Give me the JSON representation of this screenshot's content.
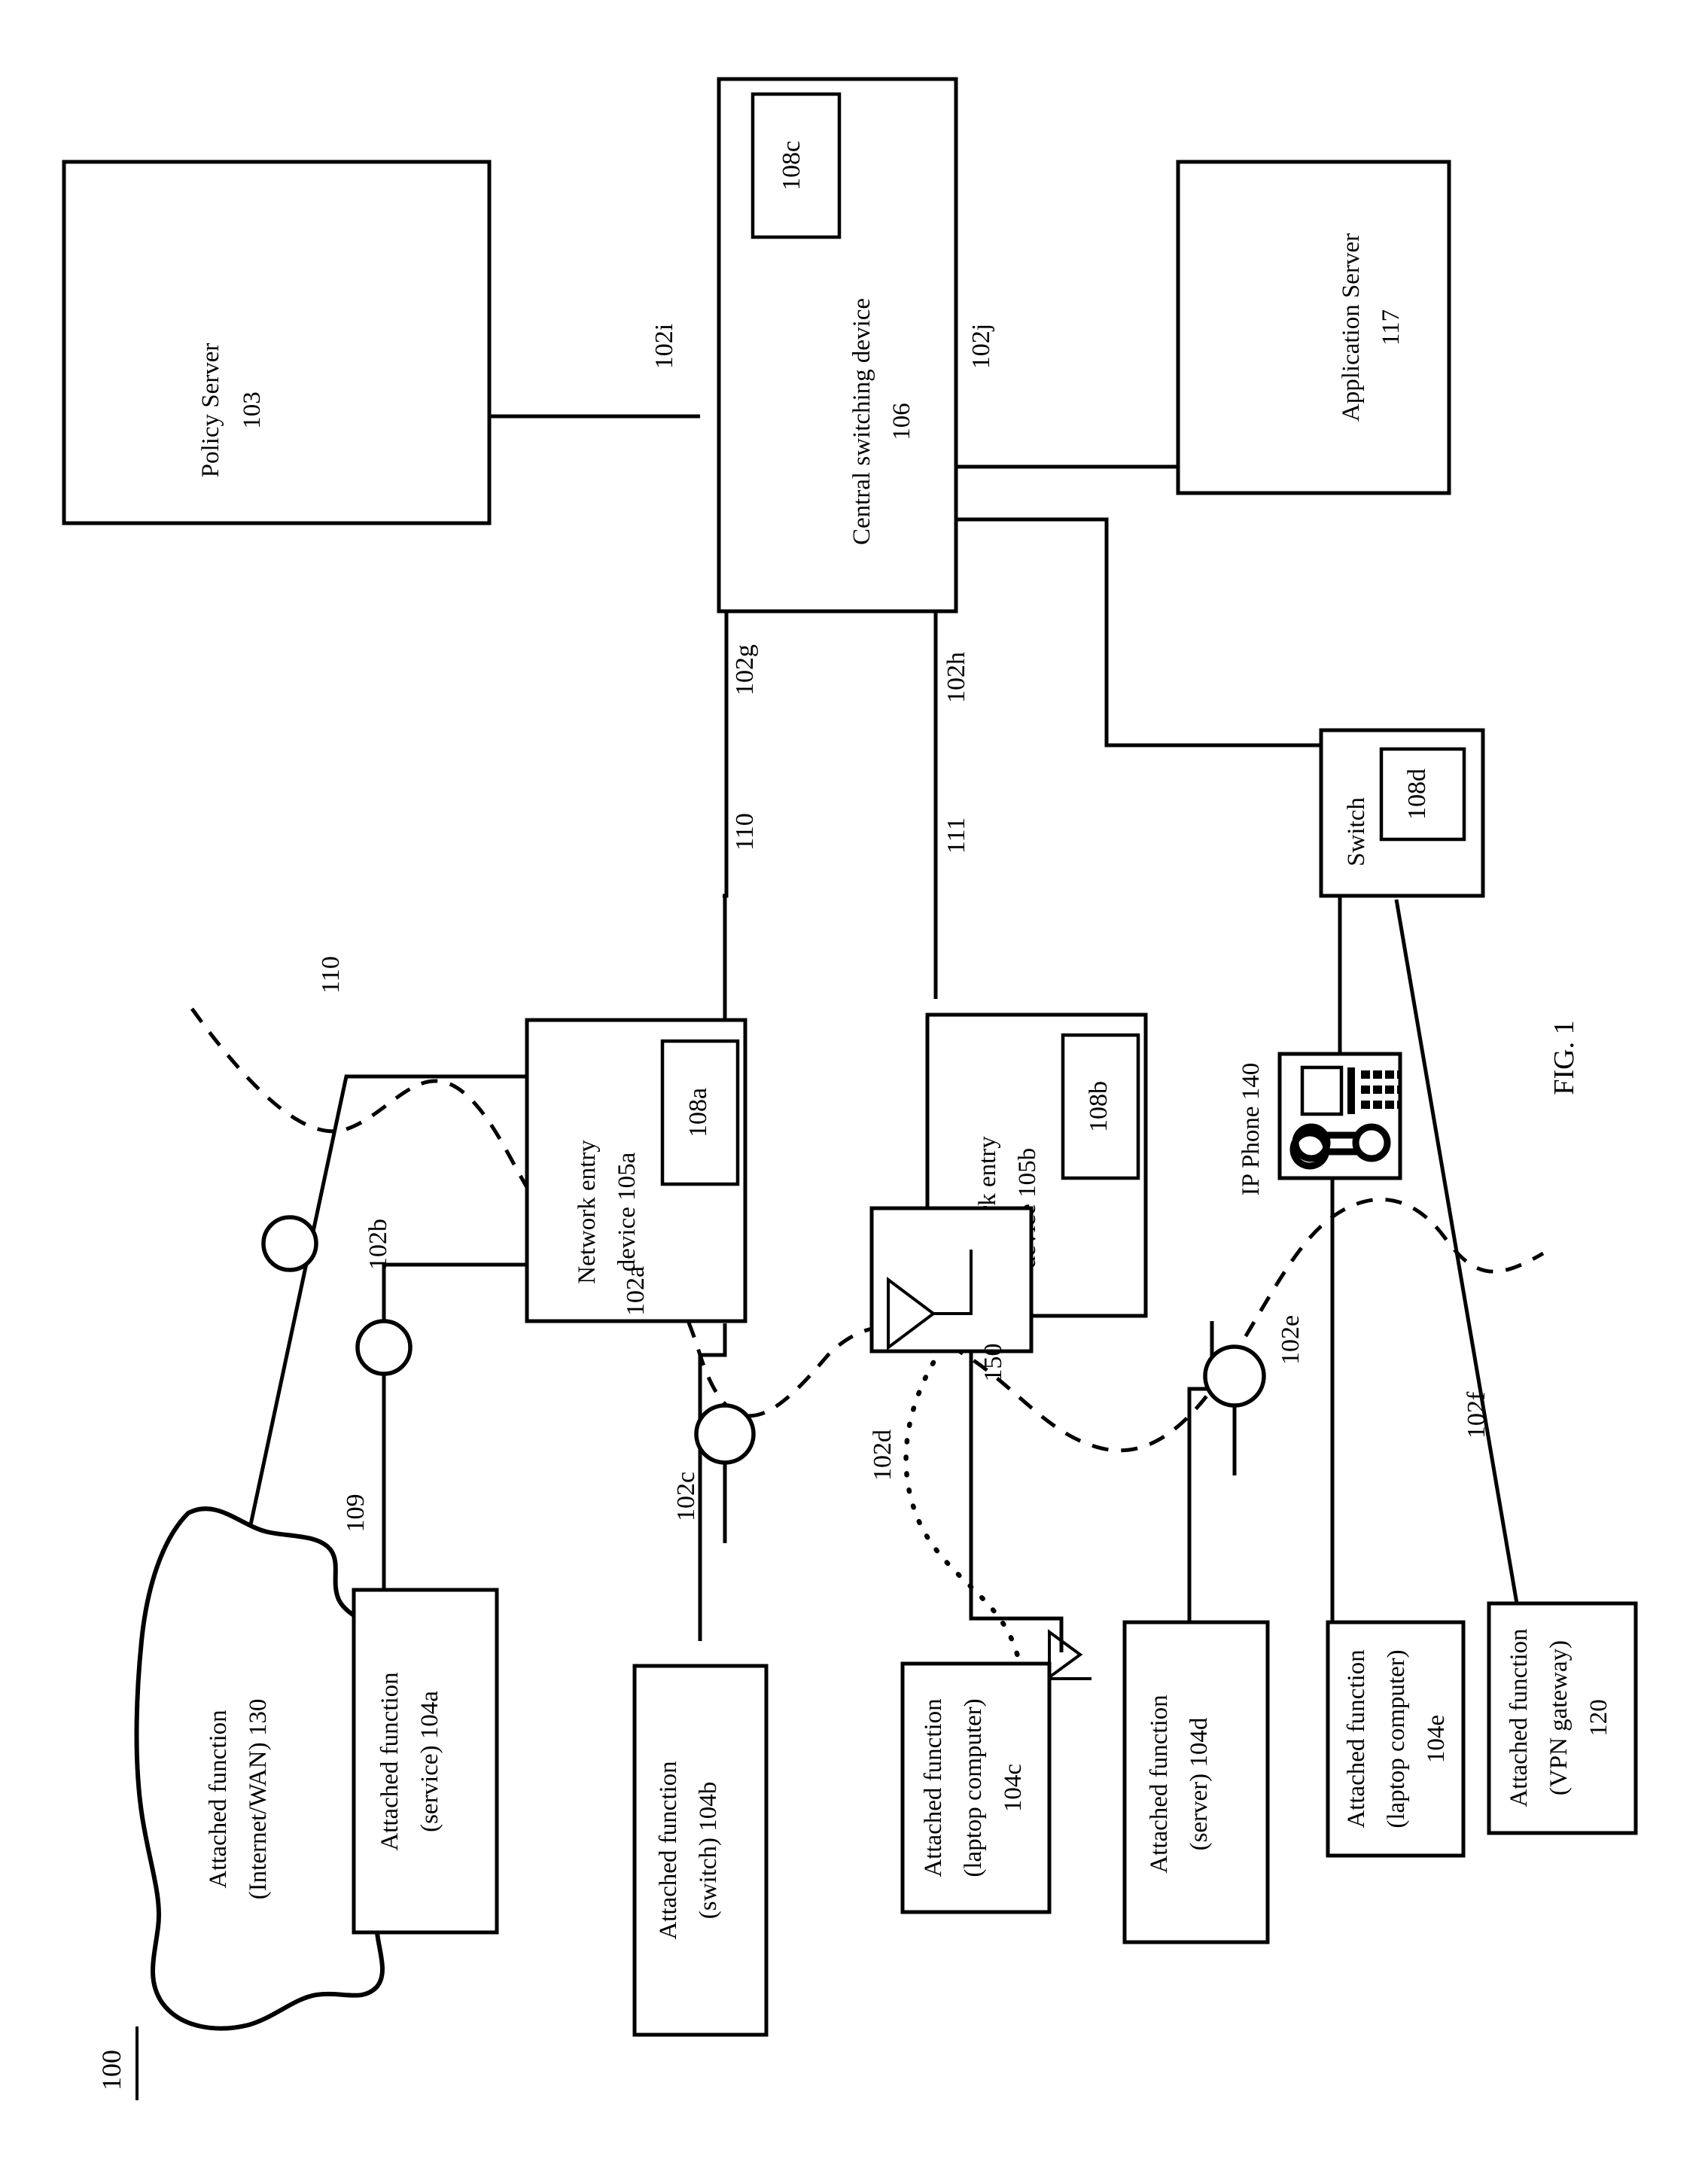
{
  "figure": {
    "label": "FIG. 1",
    "system_number": "100"
  },
  "nodes": {
    "policy_server": {
      "line1": "Policy Server",
      "line2": "103"
    },
    "central_switching_device": {
      "line1": "Central switching device",
      "line2": "106",
      "submodule": "108c"
    },
    "application_server": {
      "line1": "Application Server",
      "line2": "117"
    },
    "switch": {
      "line1": "Switch",
      "submodule": "108d"
    },
    "network_entry_device_a": {
      "line1": "Network entry",
      "line2": "device 105a",
      "submodule": "108a"
    },
    "network_entry_device_b": {
      "line1": "Network entry",
      "line2": "device 105b",
      "submodule": "108b"
    },
    "ip_phone": {
      "label": "IP Phone 140"
    },
    "internet_wan": {
      "line1": "Attached function",
      "line2": "(Internet/WAN) 130"
    },
    "attached_service": {
      "line1": "Attached function",
      "line2": "(service) 104a"
    },
    "attached_switch": {
      "line1": "Attached function",
      "line2": "(switch) 104b"
    },
    "attached_laptop_c": {
      "line1": "Attached function",
      "line2": "(laptop computer)",
      "line3": "104c"
    },
    "attached_server": {
      "line1": "Attached function",
      "line2": "(server) 104d"
    },
    "attached_laptop_e": {
      "line1": "Attached function",
      "line2": "(laptop computer)",
      "line3": "104e"
    },
    "attached_vpn_gateway": {
      "line1": "Attached function",
      "line2": "(VPN gateway)",
      "line3": "120"
    }
  },
  "link_labels": {
    "l102a": "102a",
    "l102b": "102b",
    "l102c": "102c",
    "l102d": "102d",
    "l102e": "102e",
    "l102f": "102f",
    "l102g": "102g",
    "l102h": "102h",
    "l102i": "102i",
    "l102j": "102j",
    "l109": "109",
    "l110_left": "110",
    "l110_mid": "110",
    "l111": "111",
    "l150": "150"
  },
  "colors": {
    "stroke": "#000000",
    "background": "#ffffff"
  }
}
